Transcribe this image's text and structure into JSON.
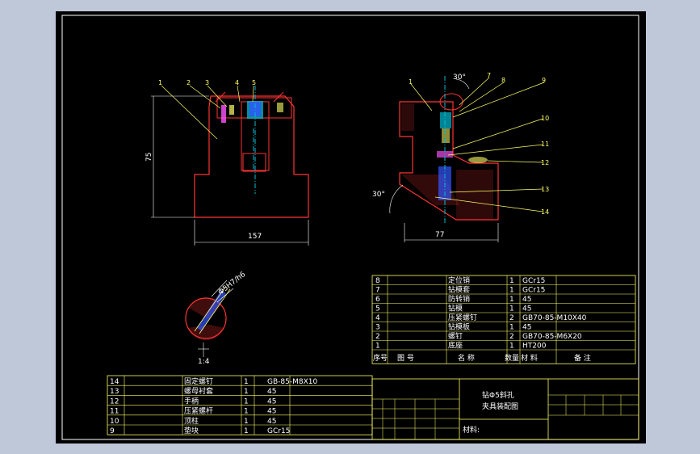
{
  "bom_upper": {
    "rows": [
      {
        "no": "8",
        "name": "定位销",
        "qty": "1",
        "mat": "GCr15",
        "note": ""
      },
      {
        "no": "7",
        "name": "钻模套",
        "qty": "1",
        "mat": "GCr15",
        "note": ""
      },
      {
        "no": "6",
        "name": "防转销",
        "qty": "1",
        "mat": "45",
        "note": ""
      },
      {
        "no": "5",
        "name": "钻模",
        "qty": "1",
        "mat": "45",
        "note": ""
      },
      {
        "no": "4",
        "name": "压紧螺钉",
        "qty": "2",
        "mat": "GB70-85-M10X40",
        "note": ""
      },
      {
        "no": "3",
        "name": "钻模板",
        "qty": "1",
        "mat": "45",
        "note": ""
      },
      {
        "no": "2",
        "name": "螺钉",
        "qty": "2",
        "mat": "GB70-85-M6X20",
        "note": ""
      },
      {
        "no": "1",
        "name": "底座",
        "qty": "1",
        "mat": "HT200",
        "note": ""
      }
    ],
    "header": {
      "no": "序号",
      "code": "图 号",
      "name": "名 称",
      "qty": "数量",
      "mat": "材 料",
      "note": "备 注"
    }
  },
  "bom_lower": {
    "rows": [
      {
        "no": "14",
        "name": "固定螺钉",
        "qty": "1",
        "mat": "GB-85-M8X10"
      },
      {
        "no": "13",
        "name": "螺母衬套",
        "qty": "1",
        "mat": "45"
      },
      {
        "no": "12",
        "name": "手柄",
        "qty": "1",
        "mat": "45"
      },
      {
        "no": "11",
        "name": "压紧螺杆",
        "qty": "1",
        "mat": "45"
      },
      {
        "no": "10",
        "name": "顶柱",
        "qty": "1",
        "mat": "45"
      },
      {
        "no": "9",
        "name": "垫块",
        "qty": "1",
        "mat": "GCr15"
      }
    ]
  },
  "title_block": {
    "drawing_title_1": "钻Φ5斜孔",
    "drawing_title_2": "夹具装配图",
    "material_label": "材料:"
  },
  "dims": {
    "front_width": "157",
    "front_height": "75",
    "side_width": "77",
    "angle_top": "30°",
    "angle_side": "30°",
    "detail_fit": "Φ5H7/h6",
    "detail_scale": "1:4"
  },
  "callouts_front": [
    "1",
    "2",
    "3",
    "4",
    "5"
  ],
  "callouts_side": [
    "1",
    "7",
    "8",
    "9",
    "10",
    "11",
    "12",
    "13",
    "14"
  ]
}
